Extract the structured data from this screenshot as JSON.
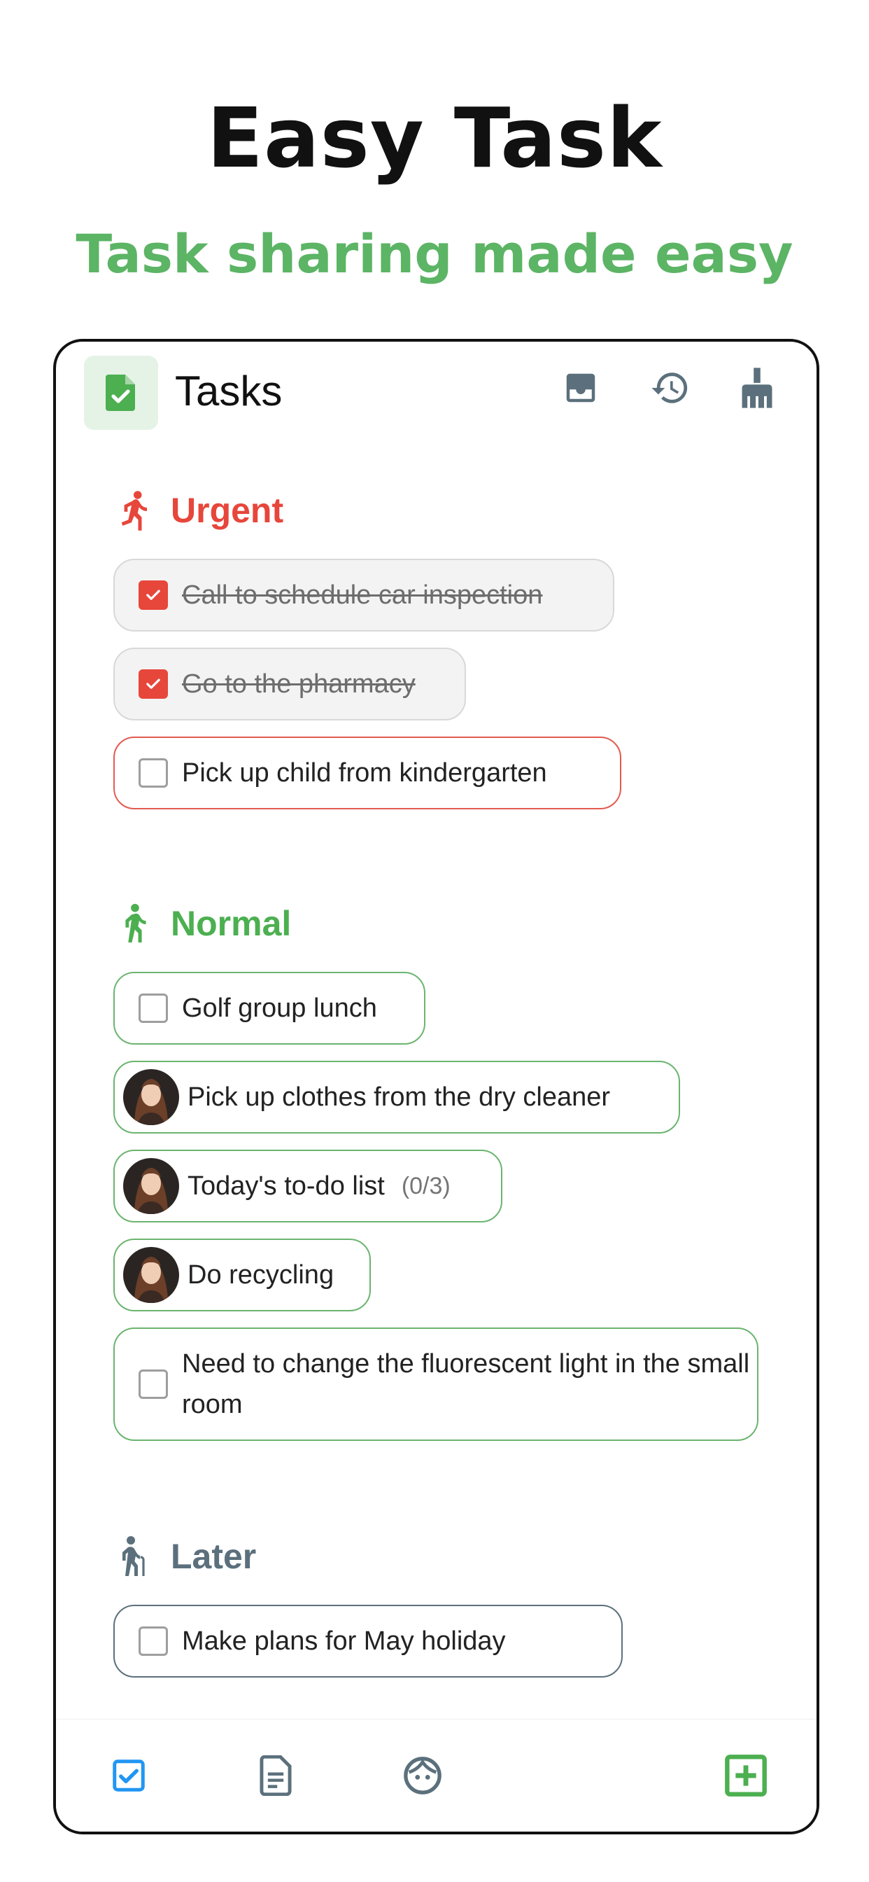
{
  "hero": {
    "title": "Easy Task",
    "subtitle": "Task sharing made easy"
  },
  "app": {
    "title": "Tasks",
    "icons": [
      "task-file-icon",
      "inbox-icon",
      "history-icon",
      "broom-icon"
    ]
  },
  "sections": {
    "urgent": {
      "label": "Urgent",
      "color": "#e7463b",
      "tasks": [
        {
          "text": "Call to schedule car inspection",
          "done": true
        },
        {
          "text": "Go to the pharmacy",
          "done": true
        },
        {
          "text": "Pick up child from kindergarten",
          "done": false
        }
      ]
    },
    "normal": {
      "label": "Normal",
      "color": "#4caf50",
      "tasks": [
        {
          "text": "Golf group lunch",
          "done": false
        },
        {
          "text": "Pick up clothes from the dry cleaner",
          "assignee": "avatar"
        },
        {
          "text": "Today's to-do list",
          "count": "(0/3)",
          "assignee": "avatar"
        },
        {
          "text": "Do recycling",
          "assignee": "avatar"
        },
        {
          "text": "Need to change the fluorescent light in the small room",
          "done": false
        }
      ]
    },
    "later": {
      "label": "Later",
      "color": "#5b707c",
      "tasks": [
        {
          "text": "Make plans for May holiday",
          "done": false
        }
      ]
    }
  },
  "bottom_nav": [
    "tasks-checkbox-icon",
    "notes-icon",
    "face-icon",
    "add-box-icon"
  ],
  "colors": {
    "brand_green": "#5cb465",
    "urgent_red": "#e7463b",
    "later_slate": "#5b707c",
    "nav_blue": "#2196f3"
  }
}
